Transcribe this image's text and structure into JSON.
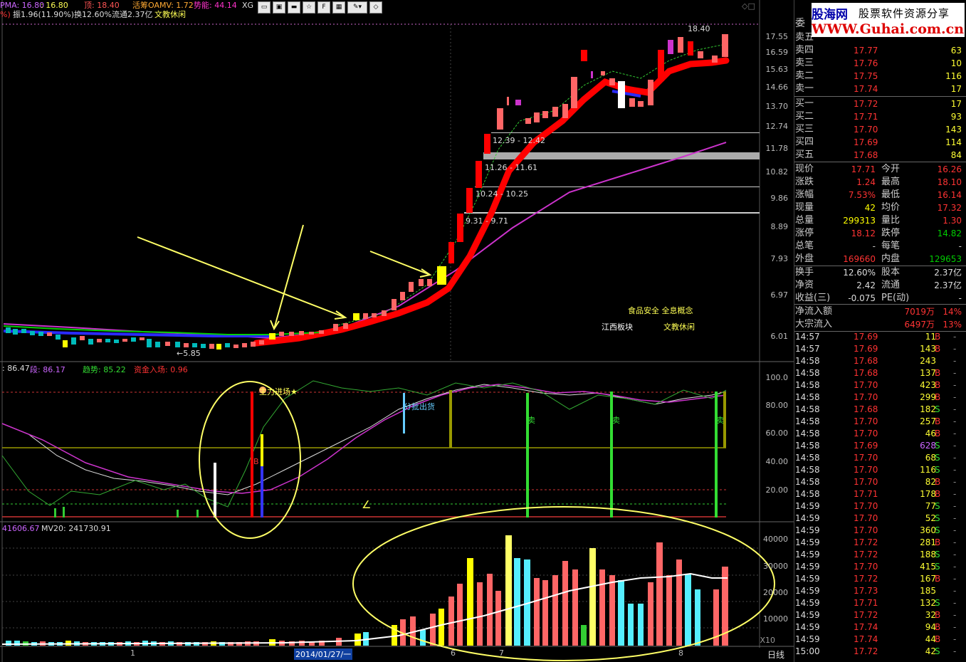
{
  "header": {
    "pma_label": "PMA: 16.80",
    "pma_value": ": 16.80",
    "top_label": "顶: 18.40",
    "ch_label": "活筹OAMV: 1.72",
    "power_label": "势能: 44.14",
    "xg_label": "XG",
    "pct_prefix": "%)",
    "amp_label": "振1.96(11.90%)",
    "turnover_label": "换12.60%",
    "float_label": "流通2.37亿",
    "concept_label": "文教休闲"
  },
  "price_axis": [
    "17.55",
    "16.59",
    "15.63",
    "14.66",
    "13.70",
    "12.74",
    "11.78",
    "10.82",
    "9.86",
    "8.89",
    "7.93",
    "6.97",
    "6.01"
  ],
  "osc_axis": [
    "100.0",
    "80.00",
    "60.00",
    "40.00",
    "20.00"
  ],
  "vol_axis": [
    "40000",
    "30000",
    "20000",
    "10000"
  ],
  "vol_multiplier": "X10",
  "annotations": {
    "peak": "18.40",
    "low": "←5.85",
    "zone1": "12.39 - 12.42",
    "zone2": "11.26 - 11.61",
    "zone3": "10.24 - 10.25",
    "zone4": "9.31 - 9.71",
    "concept_food": "食品安全 全息概念",
    "concept_jx": "江西板块",
    "concept_edu": "文教休闲",
    "main_entry": "主力进场★",
    "batch_out": "分批出货",
    "sell": "卖",
    "buy_mark": "B",
    "left_mark": "∠"
  },
  "osc_header": {
    "k": ": 86.47",
    "d": "段: 86.17",
    "trend": "趋势: 85.22",
    "fund": "资金入场: 0.96"
  },
  "vol_header": {
    "vol": "41606.67",
    "mv20": "MV20: 241730.91"
  },
  "x_axis": {
    "date_box": "2014/01/27/一",
    "tick1": "1",
    "tick6": "6",
    "tick7": "7",
    "tick8": "8",
    "period": "日线"
  },
  "brand": {
    "name": "股海网",
    "slogan": "股票软件资源分享",
    "url": "WWW.Guhai.com.cn"
  },
  "order_book": {
    "wei_label": "委",
    "asks": [
      {
        "label": "卖五",
        "price": "",
        "vol": ""
      },
      {
        "label": "卖四",
        "price": "17.77",
        "vol": "63"
      },
      {
        "label": "卖三",
        "price": "17.76",
        "vol": "10"
      },
      {
        "label": "卖二",
        "price": "17.75",
        "vol": "116"
      },
      {
        "label": "卖一",
        "price": "17.74",
        "vol": "17"
      }
    ],
    "bids": [
      {
        "label": "买一",
        "price": "17.72",
        "vol": "17"
      },
      {
        "label": "买二",
        "price": "17.71",
        "vol": "93"
      },
      {
        "label": "买三",
        "price": "17.70",
        "vol": "143"
      },
      {
        "label": "买四",
        "price": "17.69",
        "vol": "114"
      },
      {
        "label": "买五",
        "price": "17.68",
        "vol": "84"
      }
    ]
  },
  "quote_stats": [
    {
      "l1": "现价",
      "v1": "17.71",
      "l2": "今开",
      "v2": "16.26",
      "c1": "#f33",
      "c2": "#f33"
    },
    {
      "l1": "涨跌",
      "v1": "1.24",
      "l2": "最高",
      "v2": "18.10",
      "c1": "#f33",
      "c2": "#f33"
    },
    {
      "l1": "涨幅",
      "v1": "7.53%",
      "l2": "最低",
      "v2": "16.14",
      "c1": "#f33",
      "c2": "#f33"
    },
    {
      "l1": "现量",
      "v1": "42",
      "l2": "均价",
      "v2": "17.32",
      "c1": "#ff0",
      "c2": "#f33"
    },
    {
      "l1": "总量",
      "v1": "299313",
      "l2": "量比",
      "v2": "1.30",
      "c1": "#ff0",
      "c2": "#f33"
    },
    {
      "l1": "涨停",
      "v1": "18.12",
      "l2": "跌停",
      "v2": "14.82",
      "c1": "#f33",
      "c2": "#0c0"
    },
    {
      "l1": "总笔",
      "v1": "-",
      "l2": "每笔",
      "v2": "-",
      "c1": "#ccc",
      "c2": "#ccc"
    },
    {
      "l1": "外盘",
      "v1": "169660",
      "l2": "内盘",
      "v2": "129653",
      "c1": "#f33",
      "c2": "#0c0"
    }
  ],
  "quote_stats2": [
    {
      "l1": "换手",
      "v1": "12.60%",
      "l2": "股本",
      "v2": "2.37亿"
    },
    {
      "l1": "净资",
      "v1": "2.42",
      "l2": "流通",
      "v2": "2.37亿"
    },
    {
      "l1": "收益(三)",
      "v1": "-0.075",
      "l2": "PE(动)",
      "v2": "-"
    }
  ],
  "flows": [
    {
      "label": "净流入额",
      "value": "7019万",
      "pct": "14%"
    },
    {
      "label": "大宗流入",
      "value": "6497万",
      "pct": "13%"
    }
  ],
  "ticks": [
    {
      "t": "14:57",
      "p": "17.69",
      "v": "11",
      "d": "B"
    },
    {
      "t": "14:57",
      "p": "17.69",
      "v": "143",
      "d": "B"
    },
    {
      "t": "14:58",
      "p": "17.68",
      "v": "243",
      "d": ""
    },
    {
      "t": "14:58",
      "p": "17.68",
      "v": "137",
      "d": "B"
    },
    {
      "t": "14:58",
      "p": "17.70",
      "v": "423",
      "d": "B"
    },
    {
      "t": "14:58",
      "p": "17.70",
      "v": "299",
      "d": "B"
    },
    {
      "t": "14:58",
      "p": "17.68",
      "v": "182",
      "d": "S"
    },
    {
      "t": "14:58",
      "p": "17.70",
      "v": "257",
      "d": "B"
    },
    {
      "t": "14:58",
      "p": "17.70",
      "v": "46",
      "d": "B"
    },
    {
      "t": "14:58",
      "p": "17.69",
      "v": "628",
      "d": "S"
    },
    {
      "t": "14:58",
      "p": "17.70",
      "v": "68",
      "d": "S"
    },
    {
      "t": "14:58",
      "p": "17.70",
      "v": "116",
      "d": "S"
    },
    {
      "t": "14:58",
      "p": "17.70",
      "v": "82",
      "d": "B"
    },
    {
      "t": "14:58",
      "p": "17.71",
      "v": "178",
      "d": "B"
    },
    {
      "t": "14:59",
      "p": "17.70",
      "v": "77",
      "d": "S"
    },
    {
      "t": "14:59",
      "p": "17.70",
      "v": "52",
      "d": "S"
    },
    {
      "t": "14:59",
      "p": "17.70",
      "v": "360",
      "d": "S"
    },
    {
      "t": "14:59",
      "p": "17.72",
      "v": "281",
      "d": "B"
    },
    {
      "t": "14:59",
      "p": "17.72",
      "v": "188",
      "d": "S"
    },
    {
      "t": "14:59",
      "p": "17.70",
      "v": "415",
      "d": "S"
    },
    {
      "t": "14:59",
      "p": "17.72",
      "v": "167",
      "d": "B"
    },
    {
      "t": "14:59",
      "p": "17.73",
      "v": "185",
      "d": ""
    },
    {
      "t": "14:59",
      "p": "17.71",
      "v": "132",
      "d": "S"
    },
    {
      "t": "14:59",
      "p": "17.72",
      "v": "32",
      "d": "B"
    },
    {
      "t": "14:59",
      "p": "17.74",
      "v": "94",
      "d": "B"
    },
    {
      "t": "14:59",
      "p": "17.74",
      "v": "44",
      "d": "B"
    },
    {
      "t": "15:00",
      "p": "17.72",
      "v": "42",
      "d": "S"
    }
  ],
  "colors": {
    "up": "#ff3333",
    "down": "#00cc00",
    "accent_yellow": "#ffff00",
    "magenta": "#cc33cc",
    "cyan": "#55eeff"
  }
}
